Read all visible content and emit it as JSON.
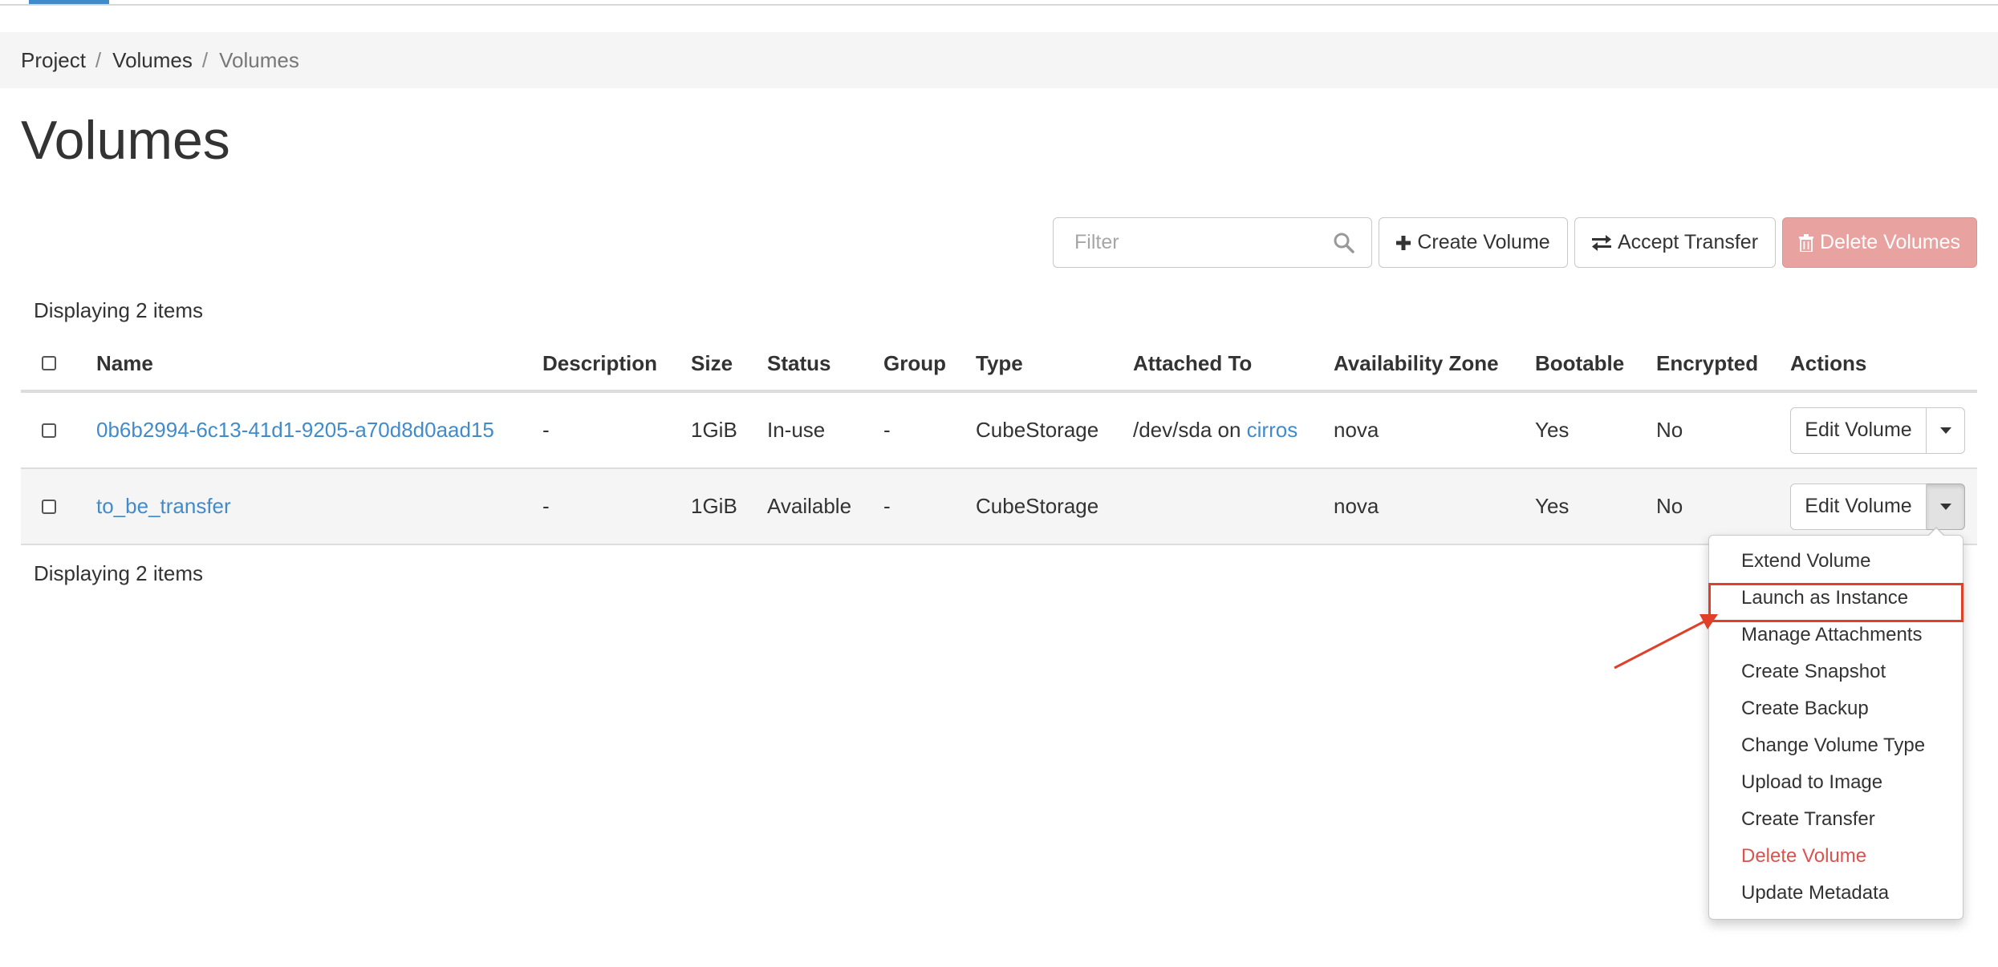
{
  "breadcrumb": {
    "items": [
      "Project",
      "Volumes"
    ],
    "separator": "/",
    "current": "Volumes"
  },
  "page": {
    "title": "Volumes"
  },
  "filter": {
    "placeholder": "Filter"
  },
  "toolbar": {
    "create_label": "Create Volume",
    "accept_label": "Accept Transfer",
    "delete_label": "Delete Volumes"
  },
  "table": {
    "count_top": "Displaying 2 items",
    "count_bottom": "Displaying 2 items",
    "columns": [
      "Name",
      "Description",
      "Size",
      "Status",
      "Group",
      "Type",
      "Attached To",
      "Availability Zone",
      "Bootable",
      "Encrypted",
      "Actions"
    ],
    "rows": [
      {
        "name": "0b6b2994-6c13-41d1-9205-a70d8d0aad15",
        "description": "-",
        "size": "1GiB",
        "status": "In-use",
        "group": "-",
        "type": "CubeStorage",
        "attached_prefix": "/dev/sda on ",
        "attached_link": "cirros",
        "zone": "nova",
        "bootable": "Yes",
        "encrypted": "No",
        "action": "Edit Volume"
      },
      {
        "name": "to_be_transfer",
        "description": "-",
        "size": "1GiB",
        "status": "Available",
        "group": "-",
        "type": "CubeStorage",
        "attached_prefix": "",
        "attached_link": "",
        "zone": "nova",
        "bootable": "Yes",
        "encrypted": "No",
        "action": "Edit Volume"
      }
    ]
  },
  "dropdown": {
    "items": [
      "Extend Volume",
      "Launch as Instance",
      "Manage Attachments",
      "Create Snapshot",
      "Create Backup",
      "Change Volume Type",
      "Upload to Image",
      "Create Transfer",
      "Delete Volume",
      "Update Metadata"
    ]
  },
  "colors": {
    "link": "#428bca",
    "danger": "#d9534f",
    "delete_button": "#e8a3a1",
    "annotation": "#e0402a"
  }
}
